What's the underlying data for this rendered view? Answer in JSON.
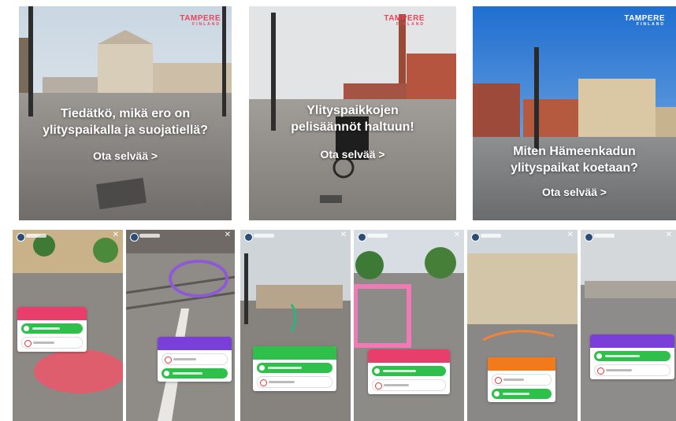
{
  "brand": {
    "name": "TAMPERE",
    "sub": "FINLAND",
    "accent": "#e8465b"
  },
  "cards": [
    {
      "headline_lines": [
        "Tiedätkö, mikä ero on",
        "ylityspaikalla ja suojatiellä?"
      ],
      "cta": "Ota selvää  >"
    },
    {
      "headline_lines": [
        "Ylityspaikkojen",
        "pelisäännöt haltuun!"
      ],
      "cta": "Ota selvää  >"
    },
    {
      "headline_lines": [
        "Miten Hämeenkadun",
        "ylityspaikat koetaan?"
      ],
      "cta": "Ota selvää  >"
    }
  ],
  "stories": [
    {
      "header_color": "#e83e6c",
      "scene": "street-pink"
    },
    {
      "header_color": "#7b3fd9",
      "scene": "tram-rails"
    },
    {
      "header_color": "#2ec04a",
      "scene": "square"
    },
    {
      "header_color": "#e83e6c",
      "scene": "park"
    },
    {
      "header_color": "#f27a1a",
      "scene": "building"
    },
    {
      "header_color": "#7b3fd9",
      "scene": "wide-street"
    }
  ]
}
